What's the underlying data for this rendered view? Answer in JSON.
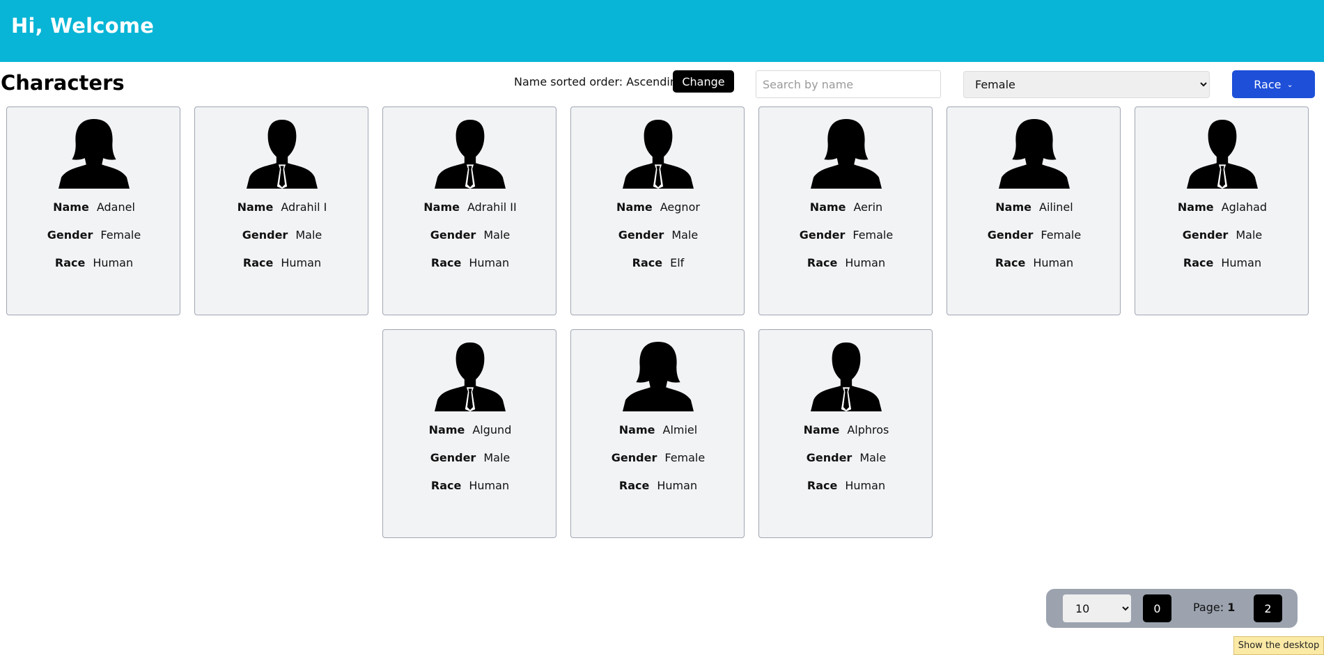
{
  "header": {
    "greeting": "Hi, Welcome"
  },
  "main": {
    "title": "Characters",
    "sort": {
      "label": "Name sorted order: Ascending",
      "change_label": "Change"
    },
    "search": {
      "placeholder": "Search by name",
      "value": ""
    },
    "gender_filter": {
      "selected": "Female"
    },
    "race_button": {
      "label": "Race"
    }
  },
  "cards": [
    {
      "name": "Adanel",
      "gender": "Female",
      "race": "Human",
      "avatar": "female-silhouette"
    },
    {
      "name": "Adrahil I",
      "gender": "Male",
      "race": "Human",
      "avatar": "male-silhouette"
    },
    {
      "name": "Adrahil II",
      "gender": "Male",
      "race": "Human",
      "avatar": "male-silhouette"
    },
    {
      "name": "Aegnor",
      "gender": "Male",
      "race": "Elf",
      "avatar": "male-silhouette"
    },
    {
      "name": "Aerin",
      "gender": "Female",
      "race": "Human",
      "avatar": "female-silhouette"
    },
    {
      "name": "Ailinel",
      "gender": "Female",
      "race": "Human",
      "avatar": "female-silhouette"
    },
    {
      "name": "Aglahad",
      "gender": "Male",
      "race": "Human",
      "avatar": "male-silhouette"
    },
    {
      "name": "Algund",
      "gender": "Male",
      "race": "Human",
      "avatar": "male-silhouette"
    },
    {
      "name": "Almiel",
      "gender": "Female",
      "race": "Human",
      "avatar": "female-silhouette"
    },
    {
      "name": "Alphros",
      "gender": "Male",
      "race": "Human",
      "avatar": "male-silhouette"
    }
  ],
  "labels": {
    "name": "Name",
    "gender": "Gender",
    "race": "Race"
  },
  "pagination": {
    "page_size": "10",
    "prev_label": "0",
    "page_label": "Page:",
    "current_page": "1",
    "next_label": "2"
  },
  "taskbar": {
    "show_desktop": "Show the desktop"
  },
  "colors": {
    "header_bg": "#08b5d6",
    "race_button_bg": "#1d4fd8",
    "card_bg": "#f2f3f5",
    "pager_bg": "#9ca3af"
  }
}
